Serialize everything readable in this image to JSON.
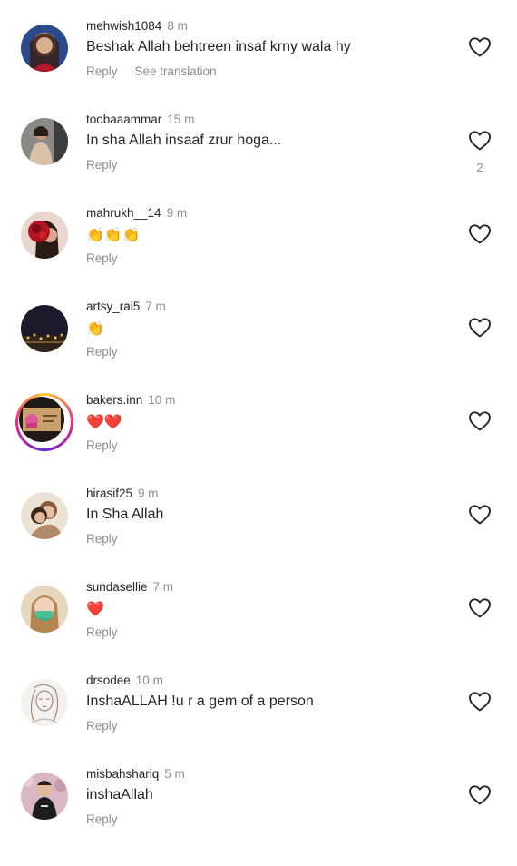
{
  "comments": [
    {
      "username": "mehwish1084",
      "time": "8 m",
      "text": "Beshak Allah behtreen insaf krny wala hy",
      "reply_label": "Reply",
      "translation_label": "See translation",
      "likes": null
    },
    {
      "username": "toobaaammar",
      "time": "15 m",
      "text": "In sha Allah insaaf zrur hoga...",
      "reply_label": "Reply",
      "likes": "2"
    },
    {
      "username": "mahrukh__14",
      "time": "9 m",
      "text": "👏👏👏",
      "reply_label": "Reply",
      "likes": null
    },
    {
      "username": "artsy_rai5",
      "time": "7 m",
      "text": "👏",
      "reply_label": "Reply",
      "likes": null
    },
    {
      "username": "bakers.inn",
      "time": "10 m",
      "text": "❤️❤️",
      "reply_label": "Reply",
      "likes": null
    },
    {
      "username": "hirasif25",
      "time": "9 m",
      "text": "In Sha Allah",
      "reply_label": "Reply",
      "likes": null
    },
    {
      "username": "sundasellie",
      "time": "7 m",
      "text": "❤️",
      "reply_label": "Reply",
      "likes": null
    },
    {
      "username": "drsodee",
      "time": "10 m",
      "text": "InshaALLAH !u r a gem of a person",
      "reply_label": "Reply",
      "likes": null
    },
    {
      "username": "misbahshariq",
      "time": "5 m",
      "text": "inshaAllah",
      "reply_label": "Reply",
      "likes": null
    }
  ],
  "icons": {
    "like": "heart-outline-icon"
  },
  "colors": {
    "text": "#262626",
    "secondary": "#8e8e8e",
    "background": "#ffffff"
  }
}
